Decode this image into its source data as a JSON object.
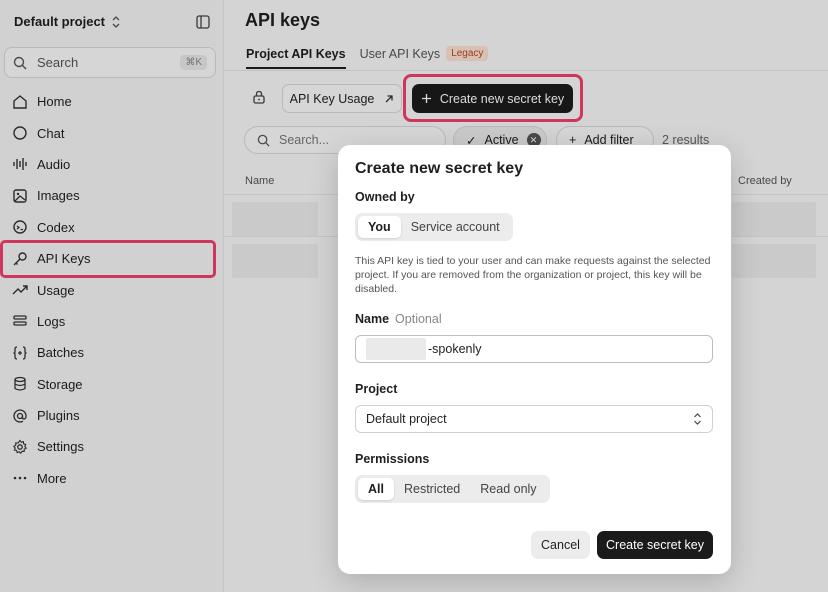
{
  "sidebar": {
    "project_name": "Default project",
    "search_label": "Search",
    "search_shortcut": "⌘K",
    "items": [
      {
        "label": "Home",
        "icon": "home-icon"
      },
      {
        "label": "Chat",
        "icon": "chat-icon"
      },
      {
        "label": "Audio",
        "icon": "audio-icon"
      },
      {
        "label": "Images",
        "icon": "image-icon"
      },
      {
        "label": "Codex",
        "icon": "codex-icon"
      },
      {
        "label": "API Keys",
        "icon": "key-icon"
      },
      {
        "label": "Usage",
        "icon": "trend-icon"
      },
      {
        "label": "Logs",
        "icon": "logs-icon"
      },
      {
        "label": "Batches",
        "icon": "braces-icon"
      },
      {
        "label": "Storage",
        "icon": "database-icon"
      },
      {
        "label": "Plugins",
        "icon": "at-icon"
      },
      {
        "label": "Settings",
        "icon": "gear-icon"
      },
      {
        "label": "More",
        "icon": "more-icon"
      }
    ]
  },
  "main": {
    "title": "API keys",
    "tabs": {
      "project": "Project API Keys",
      "user": "User API Keys",
      "legacy_badge": "Legacy"
    },
    "toolbar": {
      "usage_label": "API Key Usage",
      "create_label": "Create new secret key"
    },
    "filters": {
      "search_placeholder": "Search...",
      "active_chip": "Active",
      "add_filter": "Add filter",
      "results": "2 results"
    },
    "table": {
      "col_name": "Name",
      "col_created_by": "Created by"
    }
  },
  "modal": {
    "title": "Create new secret key",
    "owned_by_label": "Owned by",
    "owned_options": [
      "You",
      "Service account"
    ],
    "description": "This API key is tied to your user and can make requests against the selected project. If you are removed from the organization or project, this key will be disabled.",
    "name_label": "Name",
    "name_optional": "Optional",
    "name_value_suffix": "-spokenly",
    "project_label": "Project",
    "project_value": "Default project",
    "permissions_label": "Permissions",
    "permission_options": [
      "All",
      "Restricted",
      "Read only"
    ],
    "cancel_label": "Cancel",
    "submit_label": "Create secret key"
  },
  "colors": {
    "highlight": "#f0406b",
    "primary_button": "#1b1b1b",
    "legacy_badge_bg": "#fde0d2"
  }
}
